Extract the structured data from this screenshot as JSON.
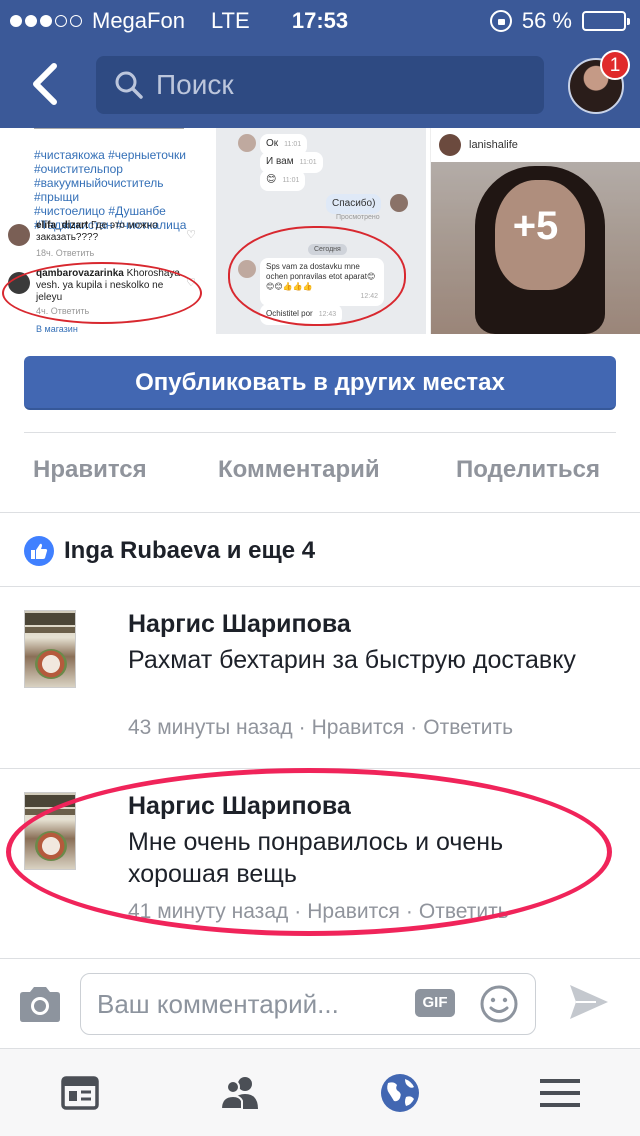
{
  "status_bar": {
    "carrier": "MegaFon",
    "network": "LTE",
    "time": "17:53",
    "battery": "56 %",
    "battery_level": 0.56,
    "signal_bars_filled": 3,
    "signal_bars_total": 5
  },
  "nav": {
    "search_placeholder": "Поиск",
    "notification_count": "1"
  },
  "photos": {
    "photo1": {
      "hashtags": [
        "#чистаякожа #черныеточки",
        "#очистительпор",
        "#вакуумныйочиститель #прыщи",
        "#чистоелицо #Душанбе",
        "#Таджикистан #чисткалица"
      ],
      "comment1_user": "elifa_dizart",
      "comment1_text": "Где это можно заказать????",
      "comment1_meta": "18ч.  Ответить",
      "comment2_user": "qambarovazarinka",
      "comment2_text": "Khoroshaya vesh. ya kupila i neskolko ne jeleyu",
      "comment2_meta": "4ч.    Ответить",
      "footer": "В магазин"
    },
    "photo2": {
      "msg1": "Ок",
      "msg2": "И вам",
      "msg3": "😊",
      "msg4": "Спасибо)",
      "msg4_status": "Просмотрено",
      "separator": "Сегодня",
      "msg5": "Sps vam za dostavku mne ochen ponravilas etot aparat😊😊😊👍👍👍",
      "msg6": "Ochistitel por",
      "time1": "11:01",
      "time5": "12:42",
      "time6": "12:43"
    },
    "photo3": {
      "username": "lanishalife",
      "more_count": "+5"
    }
  },
  "publish_button": "Опубликовать в других местах",
  "actions": {
    "like": "Нравится",
    "comment": "Комментарий",
    "share": "Поделиться"
  },
  "likes_summary": "Inga Rubaeva и еще 4",
  "comments": [
    {
      "author": "Наргис Шарипова",
      "text": "Рахмат бехтарин  за быструю доставку",
      "time": "43 минуты назад",
      "like": "Нравится",
      "reply": "Ответить"
    },
    {
      "author": "Наргис Шарипова",
      "text": "Мне очень понравилось и  очень хорошая вещь",
      "time": "41 минуту назад",
      "like": "Нравится",
      "reply": "Ответить"
    }
  ],
  "composer": {
    "placeholder": "Ваш комментарий...",
    "gif_label": "GIF"
  },
  "colors": {
    "brand": "#3b5998",
    "button": "#4267b2",
    "highlight": "#f0245a",
    "annotation_red": "#d8282f"
  },
  "icons": {
    "back": "chevron-left-icon",
    "search": "search-icon",
    "like": "thumbs-up-icon",
    "camera": "camera-icon",
    "emoji": "smiley-icon",
    "send": "send-icon",
    "tabs": [
      "news-feed-icon",
      "friends-icon",
      "globe-icon",
      "menu-icon"
    ]
  }
}
